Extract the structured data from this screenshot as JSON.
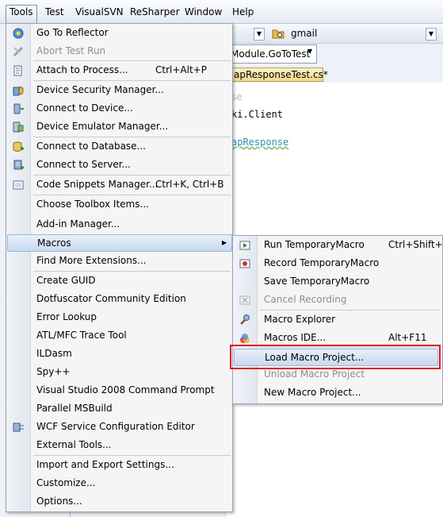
{
  "menubar": {
    "items": [
      "Tools",
      "Test",
      "VisualSVN",
      "ReSharper",
      "Window",
      "Help"
    ]
  },
  "background": {
    "combo_text": "gmail",
    "module_tab": "Module.GoToTest",
    "file_tab": "apResponseTest.cs*",
    "code_faint": "se",
    "code_line1": "ki.Client",
    "code_line2": "apResponse"
  },
  "tools_menu": {
    "items": [
      {
        "label": "Go To Reflector",
        "icon": "reflector-icon"
      },
      {
        "label": "Abort Test Run",
        "icon": "abort-icon",
        "disabled": true
      },
      {
        "label": "Attach to Process...",
        "shortcut": "Ctrl+Alt+P",
        "icon": "attach-process-icon"
      },
      {
        "label": "Device Security Manager...",
        "icon": "device-security-icon"
      },
      {
        "label": "Connect to Device...",
        "icon": "connect-device-icon"
      },
      {
        "label": "Device Emulator Manager...",
        "icon": "emulator-icon"
      },
      {
        "label": "Connect to Database...",
        "icon": "database-icon"
      },
      {
        "label": "Connect to Server...",
        "icon": "server-icon"
      },
      {
        "label": "Code Snippets Manager...",
        "shortcut": "Ctrl+K, Ctrl+B",
        "icon": "snippets-icon"
      },
      {
        "label": "Choose Toolbox Items..."
      },
      {
        "label": "Add-in Manager..."
      },
      {
        "label": "Macros",
        "submenu": true
      },
      {
        "label": "Find More Extensions..."
      },
      {
        "label": "Create GUID"
      },
      {
        "label": "Dotfuscator Community Edition"
      },
      {
        "label": "Error Lookup"
      },
      {
        "label": "ATL/MFC Trace Tool"
      },
      {
        "label": "ILDasm"
      },
      {
        "label": "Spy++"
      },
      {
        "label": "Visual Studio 2008 Command Prompt"
      },
      {
        "label": "Parallel MSBuild"
      },
      {
        "label": "WCF Service Configuration Editor",
        "icon": "wcf-icon"
      },
      {
        "label": "External Tools..."
      },
      {
        "label": "Import and Export Settings..."
      },
      {
        "label": "Customize..."
      },
      {
        "label": "Options..."
      }
    ]
  },
  "macros_menu": {
    "items": [
      {
        "label": "Run TemporaryMacro",
        "shortcut": "Ctrl+Shift+P",
        "icon": "run-macro-icon"
      },
      {
        "label": "Record TemporaryMacro",
        "icon": "record-macro-icon"
      },
      {
        "label": "Save TemporaryMacro"
      },
      {
        "label": "Cancel Recording",
        "disabled": true,
        "icon": "cancel-recording-icon"
      },
      {
        "label": "Macro Explorer",
        "icon": "macro-explorer-icon"
      },
      {
        "label": "Macros IDE...",
        "shortcut": "Alt+F11",
        "icon": "macros-ide-icon"
      },
      {
        "label": "Load Macro Project..."
      },
      {
        "label": "Unload Macro Project",
        "disabled": true
      },
      {
        "label": "New Macro Project..."
      }
    ]
  },
  "colors": {
    "highlight_border": "#9db5d8",
    "callout_red": "#e0191f"
  }
}
